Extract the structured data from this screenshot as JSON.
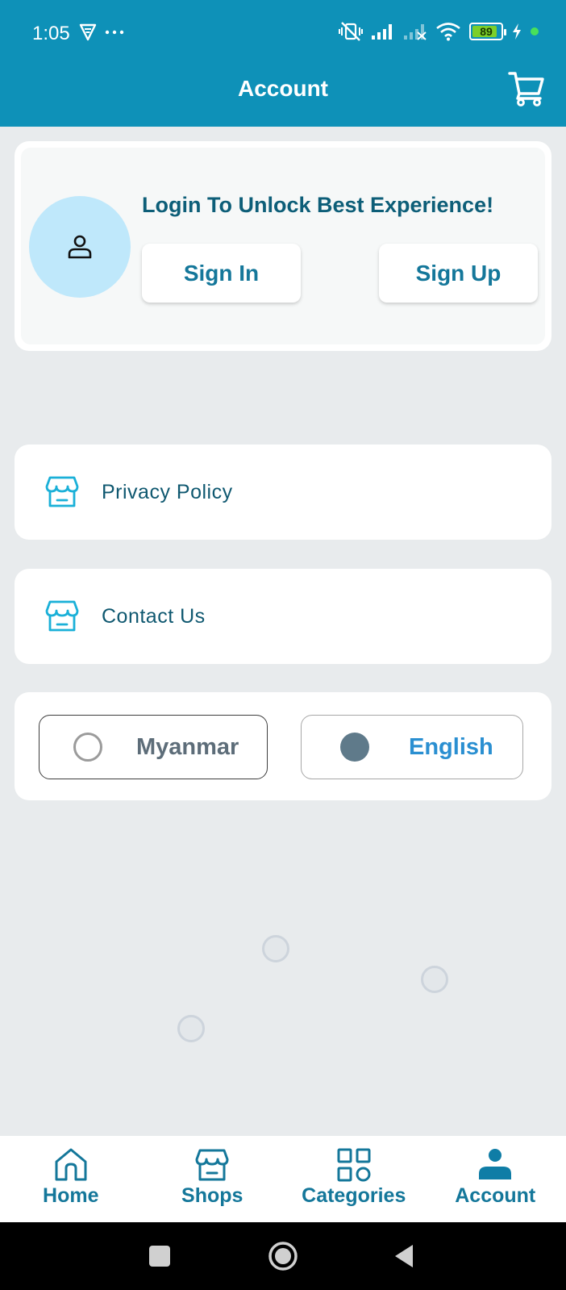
{
  "status": {
    "time": "1:05",
    "battery": "89",
    "battery_level": 0.89
  },
  "appbar": {
    "title": "Account",
    "cart_icon": "cart-icon"
  },
  "login": {
    "title": "Login To Unlock Best Experience!",
    "signin_label": "Sign In",
    "signup_label": "Sign Up",
    "avatar_icon": "person-icon"
  },
  "menu": [
    {
      "label": "Privacy Policy",
      "icon": "store-icon"
    },
    {
      "label": "Contact Us",
      "icon": "store-icon"
    }
  ],
  "language": {
    "options": [
      {
        "label": "Myanmar",
        "selected": false
      },
      {
        "label": "English",
        "selected": true
      }
    ]
  },
  "bottom_nav": [
    {
      "label": "Home",
      "icon": "home-icon"
    },
    {
      "label": "Shops",
      "icon": "store-icon"
    },
    {
      "label": "Categories",
      "icon": "grid-icon"
    },
    {
      "label": "Account",
      "icon": "person-icon",
      "active": true
    }
  ],
  "colors": {
    "primary": "#0e91b8",
    "heading": "#0d5e78",
    "accent_text": "#14779a",
    "avatar_bg": "#bfe8fb",
    "english_text": "#2a8fd1",
    "background": "#e8ebed"
  }
}
